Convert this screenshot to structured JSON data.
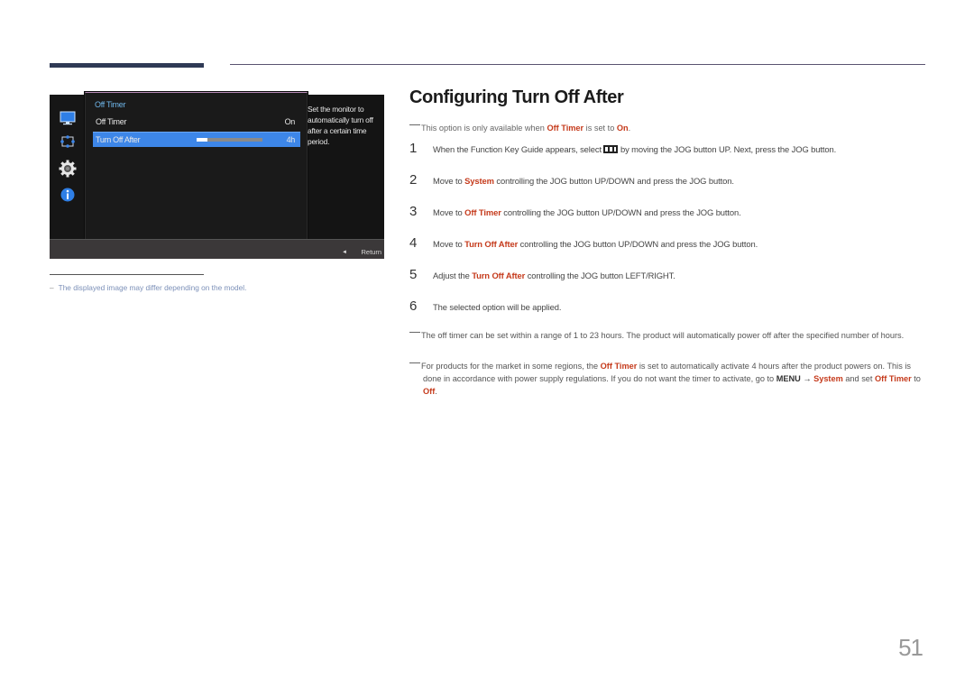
{
  "osd": {
    "sidebar_icons": [
      "monitor-icon",
      "size-position-icon",
      "gear-icon",
      "info-icon"
    ],
    "panel_title": "Off Timer",
    "rows": [
      {
        "label": "Off Timer",
        "value": "On",
        "selected": false
      },
      {
        "label": "Turn Off After",
        "value": "4h",
        "selected": true,
        "slider_fraction": 0.17
      }
    ],
    "description": "Set the monitor to automatically turn off after a certain time period.",
    "footer": {
      "back_glyph": "◄",
      "return_label": "Return"
    },
    "colors": {
      "accent": "#3d86e8",
      "title": "#6fb6ea"
    }
  },
  "footnote": {
    "text": "The displayed image may differ depending on the model."
  },
  "section": {
    "title": "Configuring Turn Off After",
    "availability_note": {
      "pre": "This option is only available when ",
      "hl1": "Off Timer",
      "mid": " is set to ",
      "hl2": "On",
      "post": "."
    },
    "steps": [
      {
        "num": "1",
        "pre": "When the Function Key Guide appears, select ",
        "icon": "function-key-icon",
        "post": " by moving the JOG button UP. Next, press the JOG button."
      },
      {
        "num": "2",
        "pre": "Move to ",
        "hl": "System",
        "post": " controlling the JOG button UP/DOWN and press the JOG button."
      },
      {
        "num": "3",
        "pre": "Move to ",
        "hl": "Off Timer",
        "post": " controlling the JOG button UP/DOWN and press the JOG button."
      },
      {
        "num": "4",
        "pre": "Move to ",
        "hl": "Turn Off After",
        "post": " controlling the JOG button UP/DOWN and press the JOG button."
      },
      {
        "num": "5",
        "pre": "Adjust the ",
        "hl": "Turn Off After",
        "post": " controlling the JOG button LEFT/RIGHT."
      },
      {
        "num": "6",
        "pre": "The selected option will be applied.",
        "hl": "",
        "post": ""
      }
    ],
    "range_note": "The off timer can be set within a range of 1 to 23 hours. The product will automatically power off after the specified number of hours.",
    "region_note": {
      "p1": "For products for the market in some regions, the ",
      "hl1": "Off Timer",
      "p2": " is set to automatically activate 4 hours after the product powers on. This is done in accordance with power supply regulations. If you do not want the timer to activate, go to ",
      "menu": "MENU →",
      "p3": " ",
      "hl2": "System",
      "p4": " and set ",
      "hl3": "Off Timer",
      "p5": " to ",
      "hl4": "Off",
      "p6": "."
    },
    "highlight_color": "#c53a1b"
  },
  "page_number": "51"
}
